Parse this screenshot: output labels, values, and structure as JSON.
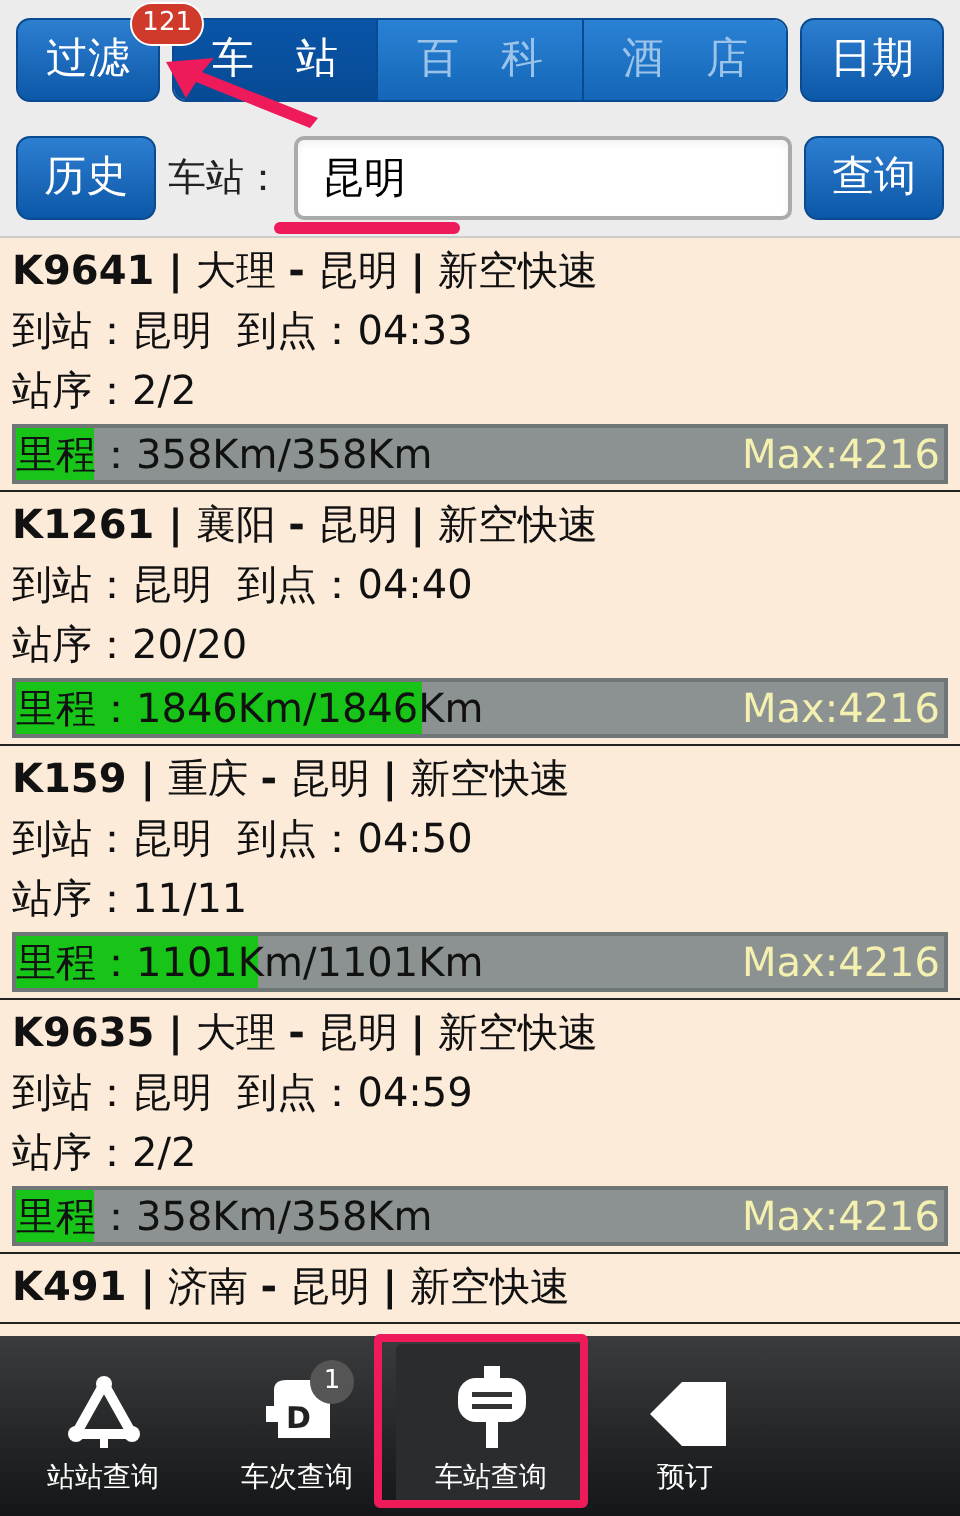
{
  "top_bar": {
    "filter_button": {
      "label": "过滤",
      "badge": "121"
    },
    "segments": [
      {
        "label": "车　站",
        "selected": true
      },
      {
        "label": "百　科",
        "selected": false
      },
      {
        "label": "酒　店",
        "selected": false
      }
    ],
    "date_button": "日期"
  },
  "search_bar": {
    "history_button": "历史",
    "field_label": "车站：",
    "field_value": "昆明",
    "query_button": "查询"
  },
  "results": [
    {
      "title": "**K9641 |** 大理 **-** 昆明 **|** 新空快速",
      "arrival": "到站：昆明  到点：04:33",
      "order": "站序：2/2",
      "mileage": "里程：358Km/358Km",
      "max": "Max:4216",
      "level": 0.085
    },
    {
      "title": "**K1261 |** 襄阳 **-** 昆明 **|** 新空快速",
      "arrival": "到站：昆明  到点：04:40",
      "order": "站序：20/20",
      "mileage": "里程：1846Km/1846Km",
      "max": "Max:4216",
      "level": 0.438
    },
    {
      "title": "**K159 |** 重庆 **-** 昆明 **|** 新空快速",
      "arrival": "到站：昆明  到点：04:50",
      "order": "站序：11/11",
      "mileage": "里程：1101Km/1101Km",
      "max": "Max:4216",
      "level": 0.261
    },
    {
      "title": "**K9635 |** 大理 **-** 昆明 **|** 新空快速",
      "arrival": "到站：昆明  到点：04:59",
      "order": "站序：2/2",
      "mileage": "里程：358Km/358Km",
      "max": "Max:4216",
      "level": 0.085
    },
    {
      "title": "**K491 |** 济南 **-** 昆明 **|** 新空快速"
    }
  ],
  "tab_bar": [
    {
      "label": "站站查询",
      "kind": "triangle",
      "selected": false
    },
    {
      "label": "车次查询",
      "kind": "train",
      "icon_letter": "D",
      "badge": "1",
      "selected": false
    },
    {
      "label": "车站查询",
      "kind": "sign",
      "selected": true
    },
    {
      "label": "预订",
      "kind": "ticket",
      "selected": false
    }
  ]
}
